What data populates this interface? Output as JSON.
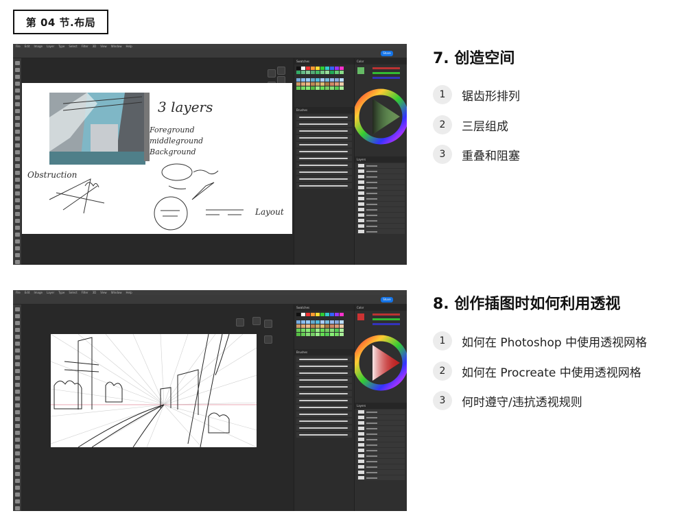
{
  "section": {
    "tag": "第 04 节.布局"
  },
  "step7": {
    "title": "7. 创造空间",
    "items": [
      {
        "num": "1",
        "text": "锯齿形排列"
      },
      {
        "num": "2",
        "text": "三层组成"
      },
      {
        "num": "3",
        "text": "重叠和阻塞"
      }
    ]
  },
  "step8": {
    "title": "8. 创作插图时如何利用透视",
    "items": [
      {
        "num": "1",
        "text": "如何在 Photoshop 中使用透视网格"
      },
      {
        "num": "2",
        "text": "如何在 Procreate 中使用透视网格"
      },
      {
        "num": "3",
        "text": "何时遵守/违抗透视规则"
      }
    ]
  },
  "screenshot1": {
    "share_label": "Share",
    "canvas_notes": {
      "heading": "3 layers",
      "layers": [
        "Foreground",
        "middleground",
        "Background"
      ],
      "obstruction": "Obstruction",
      "layout": "Layout"
    },
    "panels": {
      "swatches": "Swatches",
      "brushes": "Brushes",
      "color": "Color",
      "layers": "Layers"
    }
  },
  "screenshot2": {
    "share_label": "Share",
    "panels": {
      "swatches": "Swatches",
      "brushes": "Brushes",
      "color": "Color",
      "layers": "Layers"
    }
  },
  "colors": {
    "accent": "#1473e6",
    "app_bg": "#323232",
    "badge_bg": "#ececec",
    "sky": "#7fb7c6",
    "ink": "#2a2a2a"
  }
}
